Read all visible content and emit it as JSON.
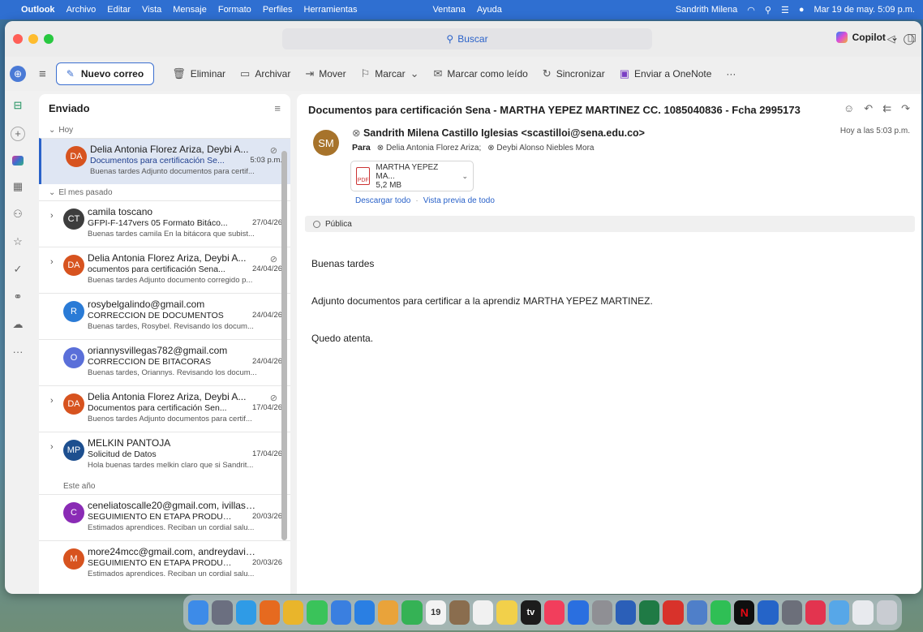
{
  "menubar": {
    "items": [
      "Outlook",
      "Archivo",
      "Editar",
      "Vista",
      "Mensaje",
      "Formato",
      "Perfiles",
      "Herramientas"
    ],
    "ventana": "Ventana",
    "ayuda": "Ayuda",
    "user": "Sandrith Milena",
    "datetime": "Mar 19 de may.  5:09 p.m."
  },
  "search": {
    "placeholder": "Buscar"
  },
  "toolbar": {
    "new_mail": "Nuevo correo",
    "delete": "Eliminar",
    "archive": "Archivar",
    "move": "Mover",
    "flag": "Marcar",
    "mark_unread": "Marcar como leído",
    "sync": "Sincronizar",
    "onenote": "Enviar a OneNote",
    "more": "···",
    "copilot": "Copilot"
  },
  "folder": {
    "title": "Enviado"
  },
  "groups": {
    "today": "Hoy",
    "last_month": "El mes pasado",
    "this_year": "Este año"
  },
  "messages": [
    {
      "initials": "DA",
      "color": "#d7531f",
      "from": "Delia Antonia Florez Ariza, Deybi A...",
      "subject": "Documentos para certificación Se...",
      "date": "5:03 p.m.",
      "preview": "Buenas tardes Adjunto documentos para certif..."
    },
    {
      "initials": "CT",
      "color": "#3d3d3d",
      "from": "camila toscano",
      "subject": "GFPI-F-147vers 05 Formato Bitáco...",
      "date": "27/04/26",
      "preview": "Buenas tardes camila En la bitácora que subist..."
    },
    {
      "initials": "DA",
      "color": "#d7531f",
      "from": "Delia Antonia Florez Ariza, Deybi A...",
      "subject": "ocumentos para certificación Sena...",
      "date": "24/04/26",
      "preview": "Buenas tardes Adjunto documento corregido p..."
    },
    {
      "initials": "R",
      "color": "#2a7bd6",
      "from": "rosybelgalindo@gmail.com",
      "subject": "CORRECCION DE DOCUMENTOS",
      "date": "24/04/26",
      "preview": "Buenas tardes, Rosybel. Revisando los docum..."
    },
    {
      "initials": "O",
      "color": "#5a6fd9",
      "from": "oriannysvillegas782@gmail.com",
      "subject": "CORRECCION DE BITACORAS",
      "date": "24/04/26",
      "preview": "Buenas tardes, Oriannys. Revisando los docum..."
    },
    {
      "initials": "DA",
      "color": "#d7531f",
      "from": "Delia Antonia Florez Ariza, Deybi A...",
      "subject": "Documentos para certificación Sen...",
      "date": "17/04/26",
      "preview": "Buenos tardes Adjunto documentos para certif..."
    },
    {
      "initials": "MP",
      "color": "#1d4f8f",
      "from": "MELKIN PANTOJA",
      "subject": "Solicitud de Datos",
      "date": "17/04/26",
      "preview": "Hola buenas tardes melkin claro que si Sandrit..."
    },
    {
      "initials": "C",
      "color": "#8a2bb5",
      "from": "ceneliatoscalle20@gmail.com, ivillasal...",
      "subject": "SEGUIMIENTO EN ETAPA PRODUC...",
      "date": "20/03/26",
      "preview": "Estimados aprendices. Reciban un cordial salu..."
    },
    {
      "initials": "M",
      "color": "#d7531f",
      "from": "more24mcc@gmail.com, andreydavid...",
      "subject": "SEGUIMIENTO EN ETAPA PRODUC...",
      "date": "20/03/26",
      "preview": "Estimados aprendices. Reciban un cordial salu..."
    }
  ],
  "reader": {
    "subject": "Documentos para certificación Sena - MARTHA YEPEZ MARTINEZ CC. 1085040836 - Fcha 2995173",
    "avatar": "SM",
    "from": "Sandrith Milena Castillo Iglesias <scastilloi@sena.edu.co>",
    "time": "Hoy a las 5:03 p.m.",
    "to_label": "Para",
    "to": [
      "Delia Antonia Florez Ariza;",
      "Deybi Alonso Niebles Mora"
    ],
    "attachment": {
      "name": "MARTHA YEPEZ MA...",
      "size": "5,2 MB",
      "type": "PDF"
    },
    "download_all": "Descargar todo",
    "preview_all": "Vista previa de todo",
    "label": "Pública",
    "body": [
      "Buenas tardes",
      "Adjunto documentos para certificar a la aprendiz MARTHA YEPEZ MARTINEZ.",
      "Quedo atenta."
    ]
  },
  "dock": {
    "calendar_day": "19",
    "tv": "tv",
    "netflix": "N"
  }
}
